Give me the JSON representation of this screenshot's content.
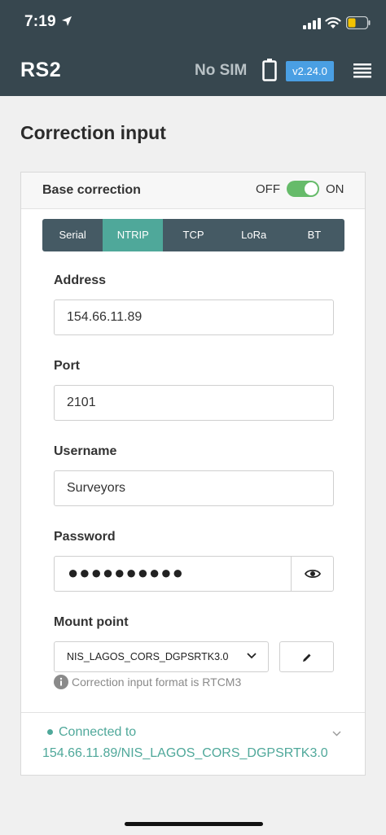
{
  "status_bar": {
    "time": "7:19"
  },
  "header": {
    "brand": "RS2",
    "sim_status": "No SIM",
    "version": "v2.24.0",
    "icons": [
      "location-arrow-icon",
      "signal-icon",
      "wifi-icon",
      "battery-icon",
      "device-battery-icon",
      "menu-icon"
    ]
  },
  "page": {
    "title": "Correction input"
  },
  "card": {
    "title": "Base correction",
    "toggle_off_label": "OFF",
    "toggle_on_label": "ON",
    "toggle_state": "on",
    "tabs": [
      {
        "label": "Serial",
        "active": false
      },
      {
        "label": "NTRIP",
        "active": true
      },
      {
        "label": "TCP",
        "active": false
      },
      {
        "label": "LoRa",
        "active": false
      },
      {
        "label": "BT",
        "active": false
      }
    ],
    "fields": {
      "address_label": "Address",
      "address_value": "154.66.11.89",
      "port_label": "Port",
      "port_value": "2101",
      "username_label": "Username",
      "username_value": "Surveyors",
      "password_label": "Password",
      "password_value": "●●●●●●●●●●",
      "mount_point_label": "Mount point",
      "mount_point_value": "NIS_LAGOS_CORS_DGPSRTK3.0"
    },
    "info_text": "Correction input format is RTCM3",
    "connection": {
      "label": "Connected to",
      "address": "154.66.11.89/NIS_LAGOS_CORS_DGPSRTK3.0"
    }
  },
  "colors": {
    "header_bg": "#37474f",
    "accent": "#4fa89a",
    "tab_bg": "#455a64",
    "version_badge": "#4a9fe3",
    "toggle_on": "#66bb6a",
    "phone_battery": "#f2c200"
  }
}
